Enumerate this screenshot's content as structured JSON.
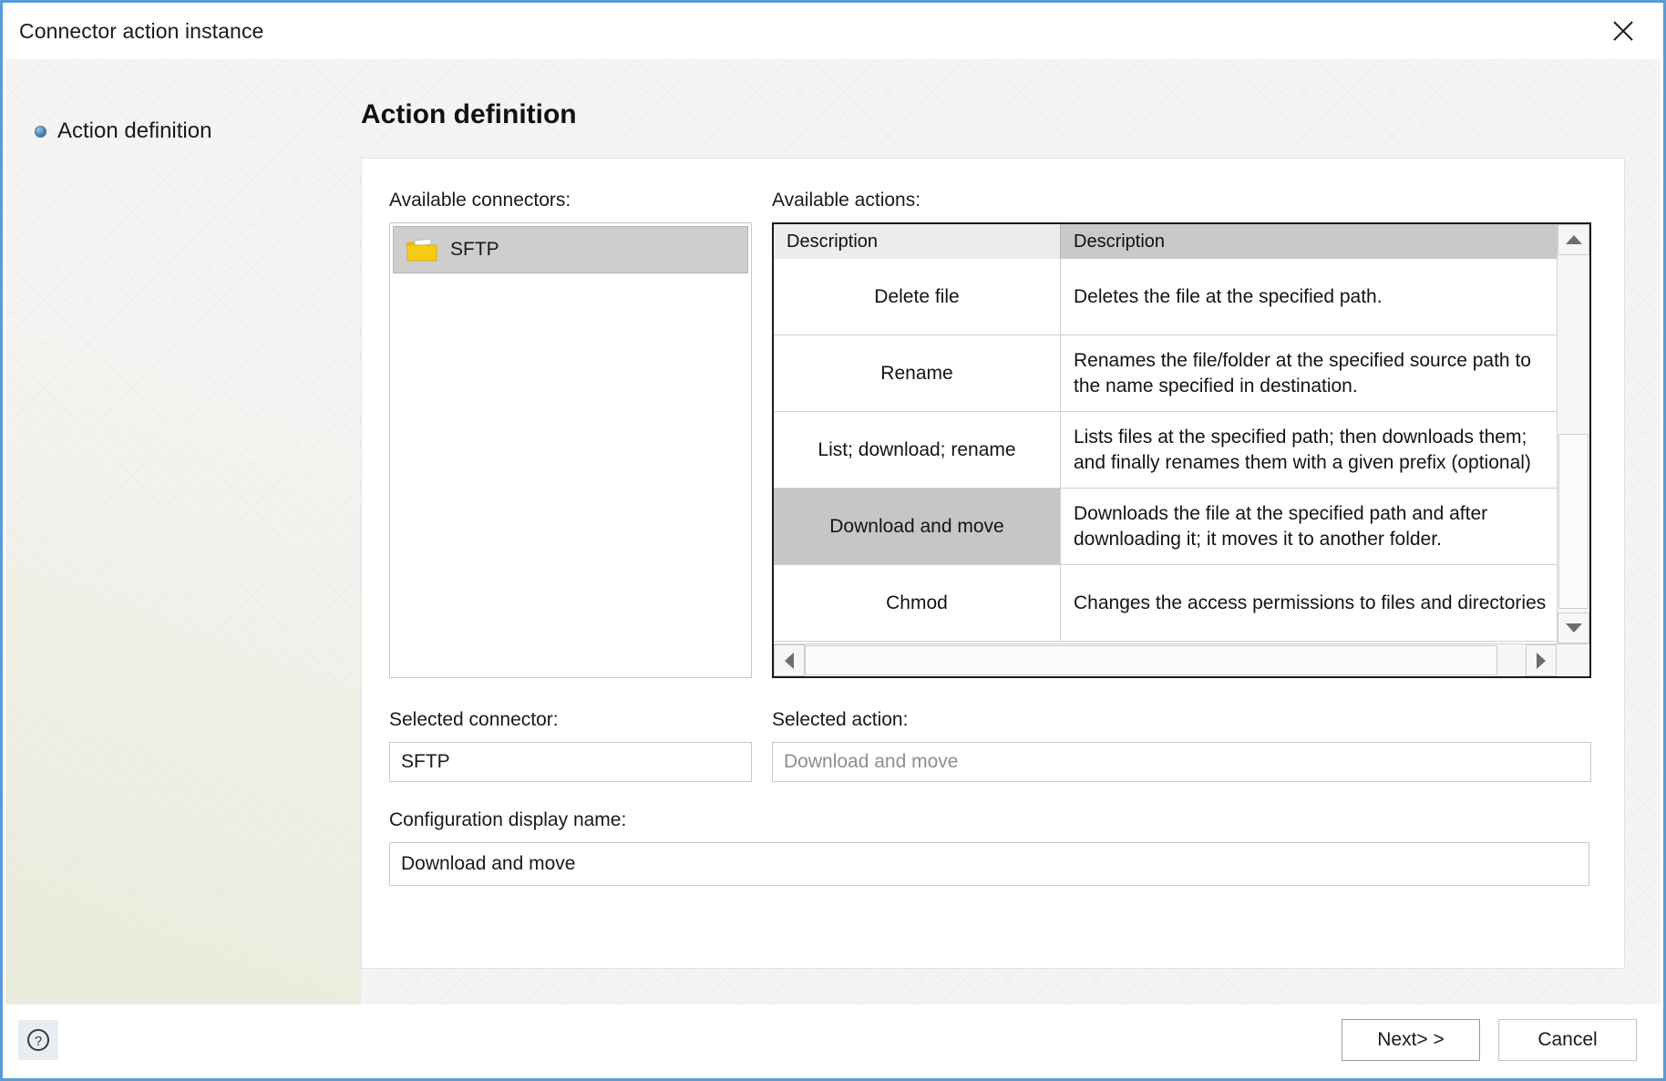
{
  "window": {
    "title": "Connector action instance",
    "close_icon": "close-icon"
  },
  "sidebar": {
    "items": [
      {
        "label": "Action definition",
        "icon": "bullet-diamond-icon",
        "selected": true
      }
    ]
  },
  "main": {
    "page_title": "Action definition",
    "connectors": {
      "label": "Available connectors:",
      "items": [
        {
          "label": "SFTP",
          "icon": "folder-icon",
          "selected": true
        }
      ]
    },
    "actions": {
      "label": "Available actions:",
      "columns": [
        "Description",
        "Description"
      ],
      "rows": [
        {
          "name": "Delete file",
          "description": "Deletes the file at the specified path.",
          "selected": false
        },
        {
          "name": "Rename",
          "description": "Renames the file/folder at the specified source path to\nthe name specified in destination.",
          "selected": false
        },
        {
          "name": "List; download; rename",
          "description": "Lists files at the specified path; then downloads them;\nand finally renames them with a given prefix (optional)",
          "selected": false
        },
        {
          "name": "Download and move",
          "description": "Downloads the file at the specified path and after\ndownloading it; it moves it to another folder.",
          "selected": true
        },
        {
          "name": "Chmod",
          "description": "Changes the access permissions to files and directories",
          "selected": false
        }
      ],
      "scrollbar_vertical": {
        "up_icon": "arrow-up-icon",
        "down_icon": "arrow-down-icon"
      },
      "scrollbar_horizontal": {
        "left_icon": "arrow-left-icon",
        "right_icon": "arrow-right-icon"
      }
    },
    "selected_connector": {
      "label": "Selected connector:",
      "value": "SFTP"
    },
    "selected_action": {
      "label": "Selected action:",
      "value": "Download and move"
    },
    "configuration_display_name": {
      "label": "Configuration display name:",
      "value": "Download and move"
    }
  },
  "footer": {
    "help_icon": "help-question-icon",
    "next_label": "Next> >",
    "cancel_label": "Cancel"
  },
  "colors": {
    "window_border": "#5b9bd5",
    "selection_gray": "#c6c6c6",
    "folder_yellow": "#f2c200",
    "accent_blue": "#3f7fb5"
  }
}
